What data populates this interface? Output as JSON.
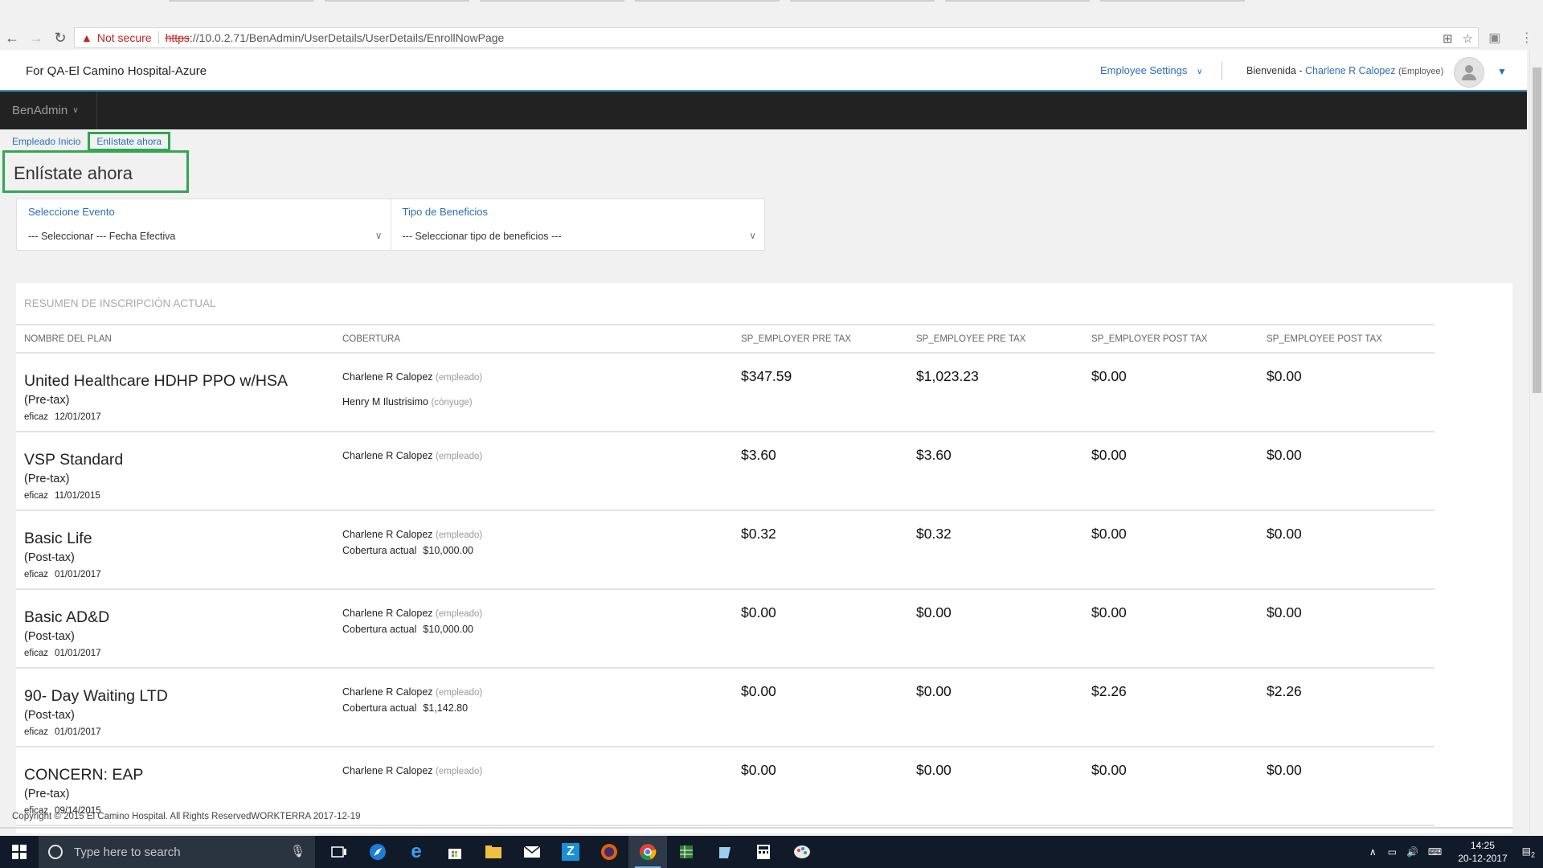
{
  "browser": {
    "security_warning": "Not secure",
    "url_scheme": "https",
    "url_rest": "://10.0.2.71/BenAdmin/UserDetails/UserDetails/EnrollNowPage"
  },
  "header": {
    "client_name": "For QA-El Camino Hospital-Azure",
    "employee_settings": "Employee Settings",
    "welcome": "Bienvenida -",
    "user_name": "Charlene R Calopez",
    "user_role": "(Employee)"
  },
  "nav": {
    "menu_label": "BenAdmin"
  },
  "breadcrumb": {
    "home": "Empleado Inicio",
    "current": "Enlístate ahora"
  },
  "page_title": "Enlístate ahora",
  "filters": {
    "event_label": "Seleccione Evento",
    "event_value": "--- Seleccionar --- Fecha Efectiva",
    "benefit_label": "Tipo de Beneficios",
    "benefit_value": "--- Seleccionar tipo de beneficios ---"
  },
  "summary": {
    "title": "RESUMEN DE INSCRIPCIÓN ACTUAL",
    "columns": [
      "NOMBRE DEL PLAN",
      "COBERTURA",
      "SP_EMPLOYER PRE TAX",
      "SP_EMPLOYEE PRE TAX",
      "SP_EMPLOYER POST TAX",
      "SP_EMPLOYEE POST TAX"
    ],
    "effective_label": "eficaz",
    "coverage_label": "Cobertura actual",
    "rows": [
      {
        "plan": "United Healthcare HDHP PPO w/HSA",
        "tax": "(Pre-tax)",
        "effective": "12/01/2017",
        "covered1_name": "Charlene R Calopez",
        "covered1_rel": "(empleado)",
        "covered2_name": "Henry M Ilustrisimo",
        "covered2_rel": "(cónyuge)",
        "coverage_amount": "",
        "er_pre": "$347.59",
        "ee_pre": "$1,023.23",
        "er_post": "$0.00",
        "ee_post": "$0.00"
      },
      {
        "plan": "VSP Standard",
        "tax": "(Pre-tax)",
        "effective": "11/01/2015",
        "covered1_name": "Charlene R Calopez",
        "covered1_rel": "(empleado)",
        "covered2_name": "",
        "covered2_rel": "",
        "coverage_amount": "",
        "er_pre": "$3.60",
        "ee_pre": "$3.60",
        "er_post": "$0.00",
        "ee_post": "$0.00"
      },
      {
        "plan": "Basic Life",
        "tax": "(Post-tax)",
        "effective": "01/01/2017",
        "covered1_name": "Charlene R Calopez",
        "covered1_rel": "(empleado)",
        "covered2_name": "",
        "covered2_rel": "",
        "coverage_amount": "$10,000.00",
        "er_pre": "$0.32",
        "ee_pre": "$0.32",
        "er_post": "$0.00",
        "ee_post": "$0.00"
      },
      {
        "plan": "Basic AD&D",
        "tax": "(Post-tax)",
        "effective": "01/01/2017",
        "covered1_name": "Charlene R Calopez",
        "covered1_rel": "(empleado)",
        "covered2_name": "",
        "covered2_rel": "",
        "coverage_amount": "$10,000.00",
        "er_pre": "$0.00",
        "ee_pre": "$0.00",
        "er_post": "$0.00",
        "ee_post": "$0.00"
      },
      {
        "plan": "90- Day Waiting LTD",
        "tax": "(Post-tax)",
        "effective": "01/01/2017",
        "covered1_name": "Charlene R Calopez",
        "covered1_rel": "(empleado)",
        "covered2_name": "",
        "covered2_rel": "",
        "coverage_amount": "$1,142.80",
        "er_pre": "$0.00",
        "ee_pre": "$0.00",
        "er_post": "$2.26",
        "ee_post": "$2.26"
      },
      {
        "plan": "CONCERN: EAP",
        "tax": "(Pre-tax)",
        "effective": "09/14/2015",
        "covered1_name": "Charlene R Calopez",
        "covered1_rel": "(empleado)",
        "covered2_name": "",
        "covered2_rel": "",
        "coverage_amount": "",
        "er_pre": "$0.00",
        "ee_pre": "$0.00",
        "er_post": "$0.00",
        "ee_post": "$0.00"
      }
    ]
  },
  "footer": {
    "copyright": "Copyright © 2015 El Camino Hospital. All Rights ReservedWORKTERRA 2017-12-19"
  },
  "taskbar": {
    "search_placeholder": "Type here to search",
    "time": "14:25",
    "date": "20-12-2017",
    "notification_count": "2",
    "icons": [
      "task-view-icon",
      "safari-like-icon",
      "edge-icon",
      "store-icon",
      "file-explorer-icon",
      "mail-icon",
      "z-app-icon",
      "firefox-icon",
      "chrome-icon",
      "spreadsheet-icon",
      "notes-icon",
      "calculator-icon",
      "paint-icon"
    ]
  },
  "colors": {
    "accent": "#2a6ebb",
    "highlight": "#2fa84f",
    "nav_bg": "#222222"
  }
}
